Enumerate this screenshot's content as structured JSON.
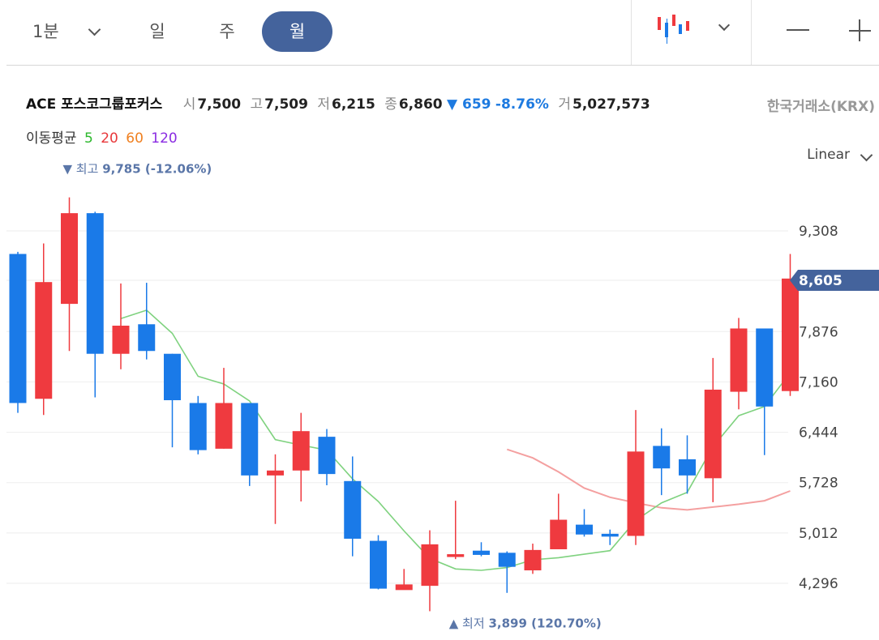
{
  "toolbar": {
    "timeframes": [
      {
        "label": "1분",
        "active": false
      },
      {
        "label": "일",
        "active": false
      },
      {
        "label": "주",
        "active": false
      },
      {
        "label": "월",
        "active": true
      }
    ],
    "chart_type_icon": "candlestick-icon",
    "zoom_out_icon": "minus-icon",
    "zoom_in_icon": "plus-icon"
  },
  "stock": {
    "name": "ACE 포스코그룹포커스",
    "open_label": "시",
    "open": "7,500",
    "high_label": "고",
    "high": "7,509",
    "low_label": "저",
    "low": "6,215",
    "close_label": "종",
    "close": "6,860",
    "change": "▼ 659",
    "change_pct": "-8.76%",
    "volume_label": "거",
    "volume": "5,027,573",
    "exchange": "한국거래소(KRX)"
  },
  "moving_average": {
    "label": "이동평균",
    "periods": [
      {
        "label": "5",
        "color": "#2db82d"
      },
      {
        "label": "20",
        "color": "#e8383b"
      },
      {
        "label": "60",
        "color": "#f08020"
      },
      {
        "label": "120",
        "color": "#8a2be2"
      }
    ]
  },
  "scale": {
    "label": "Linear"
  },
  "colors": {
    "up": "#ef3a3f",
    "down": "#1a7ae8",
    "ma5": "#7fd27f",
    "ma20": "#f4a0a0",
    "accent": "#44639c",
    "annotation": "#5a76a8"
  },
  "chart_data": {
    "type": "candlestick",
    "y_ticks": [
      "9,308",
      "8,605",
      "7,876",
      "7,160",
      "6,444",
      "5,728",
      "5,012",
      "4,296"
    ],
    "y_tick_values": [
      9308,
      8605,
      7876,
      7160,
      6444,
      5728,
      5012,
      4296
    ],
    "ylim": [
      3750,
      10000
    ],
    "current_price_label": "8,605",
    "current_price": 8605,
    "annotations": {
      "high": {
        "prefix": "▼ 최고",
        "text": "9,785 (-12.06%)",
        "value": 9785,
        "index": 2
      },
      "low": {
        "prefix": "▲ 최저",
        "text": "3,899 (120.70%)",
        "value": 3899,
        "index": 17
      }
    },
    "candles": [
      {
        "o": 8980,
        "h": 9010,
        "l": 6720,
        "c": 6860
      },
      {
        "o": 6920,
        "h": 9130,
        "l": 6690,
        "c": 8580
      },
      {
        "o": 8270,
        "h": 9785,
        "l": 7600,
        "c": 9560
      },
      {
        "o": 9560,
        "h": 9580,
        "l": 6940,
        "c": 7560
      },
      {
        "o": 7560,
        "h": 8560,
        "l": 7340,
        "c": 7960
      },
      {
        "o": 7980,
        "h": 8570,
        "l": 7480,
        "c": 7600
      },
      {
        "o": 7560,
        "h": 7560,
        "l": 6230,
        "c": 6900
      },
      {
        "o": 6860,
        "h": 6960,
        "l": 6130,
        "c": 6190
      },
      {
        "o": 6210,
        "h": 7360,
        "l": 6210,
        "c": 6860
      },
      {
        "o": 6860,
        "h": 6860,
        "l": 5680,
        "c": 5830
      },
      {
        "o": 5830,
        "h": 6130,
        "l": 5140,
        "c": 5900
      },
      {
        "o": 5900,
        "h": 6720,
        "l": 5460,
        "c": 6460
      },
      {
        "o": 6380,
        "h": 6490,
        "l": 5690,
        "c": 5850
      },
      {
        "o": 5750,
        "h": 6100,
        "l": 4680,
        "c": 4930
      },
      {
        "o": 4900,
        "h": 4980,
        "l": 4210,
        "c": 4220
      },
      {
        "o": 4200,
        "h": 4500,
        "l": 4220,
        "c": 4280
      },
      {
        "o": 4260,
        "h": 5050,
        "l": 3899,
        "c": 4850
      },
      {
        "o": 4670,
        "h": 5470,
        "l": 4640,
        "c": 4710
      },
      {
        "o": 4760,
        "h": 4880,
        "l": 4680,
        "c": 4700
      },
      {
        "o": 4730,
        "h": 4750,
        "l": 4160,
        "c": 4530
      },
      {
        "o": 4480,
        "h": 4860,
        "l": 4430,
        "c": 4770
      },
      {
        "o": 4780,
        "h": 5570,
        "l": 4780,
        "c": 5200
      },
      {
        "o": 5130,
        "h": 5350,
        "l": 4960,
        "c": 4990
      },
      {
        "o": 5000,
        "h": 5060,
        "l": 4840,
        "c": 4960
      },
      {
        "o": 4970,
        "h": 6760,
        "l": 4840,
        "c": 6170
      },
      {
        "o": 6250,
        "h": 6500,
        "l": 5550,
        "c": 5930
      },
      {
        "o": 6060,
        "h": 6400,
        "l": 5570,
        "c": 5830
      },
      {
        "o": 5790,
        "h": 7500,
        "l": 5450,
        "c": 7050
      },
      {
        "o": 7020,
        "h": 8070,
        "l": 6770,
        "c": 7920
      },
      {
        "o": 7920,
        "h": 7920,
        "l": 6120,
        "c": 6810
      },
      {
        "o": 7030,
        "h": 8980,
        "l": 6960,
        "c": 8630
      }
    ],
    "ma5": [
      null,
      null,
      null,
      null,
      8060,
      8180,
      7850,
      7240,
      7130,
      6890,
      6340,
      6260,
      6190,
      5780,
      5460,
      5040,
      4650,
      4500,
      4480,
      4520,
      4630,
      4660,
      4710,
      4760,
      5190,
      5440,
      5590,
      6240,
      6680,
      6810,
      7290
    ],
    "ma20": [
      null,
      null,
      null,
      null,
      null,
      null,
      null,
      null,
      null,
      null,
      null,
      null,
      null,
      null,
      null,
      null,
      null,
      null,
      null,
      6200,
      6080,
      5880,
      5650,
      5520,
      5440,
      5370,
      5340,
      5380,
      5420,
      5470,
      5610
    ]
  }
}
